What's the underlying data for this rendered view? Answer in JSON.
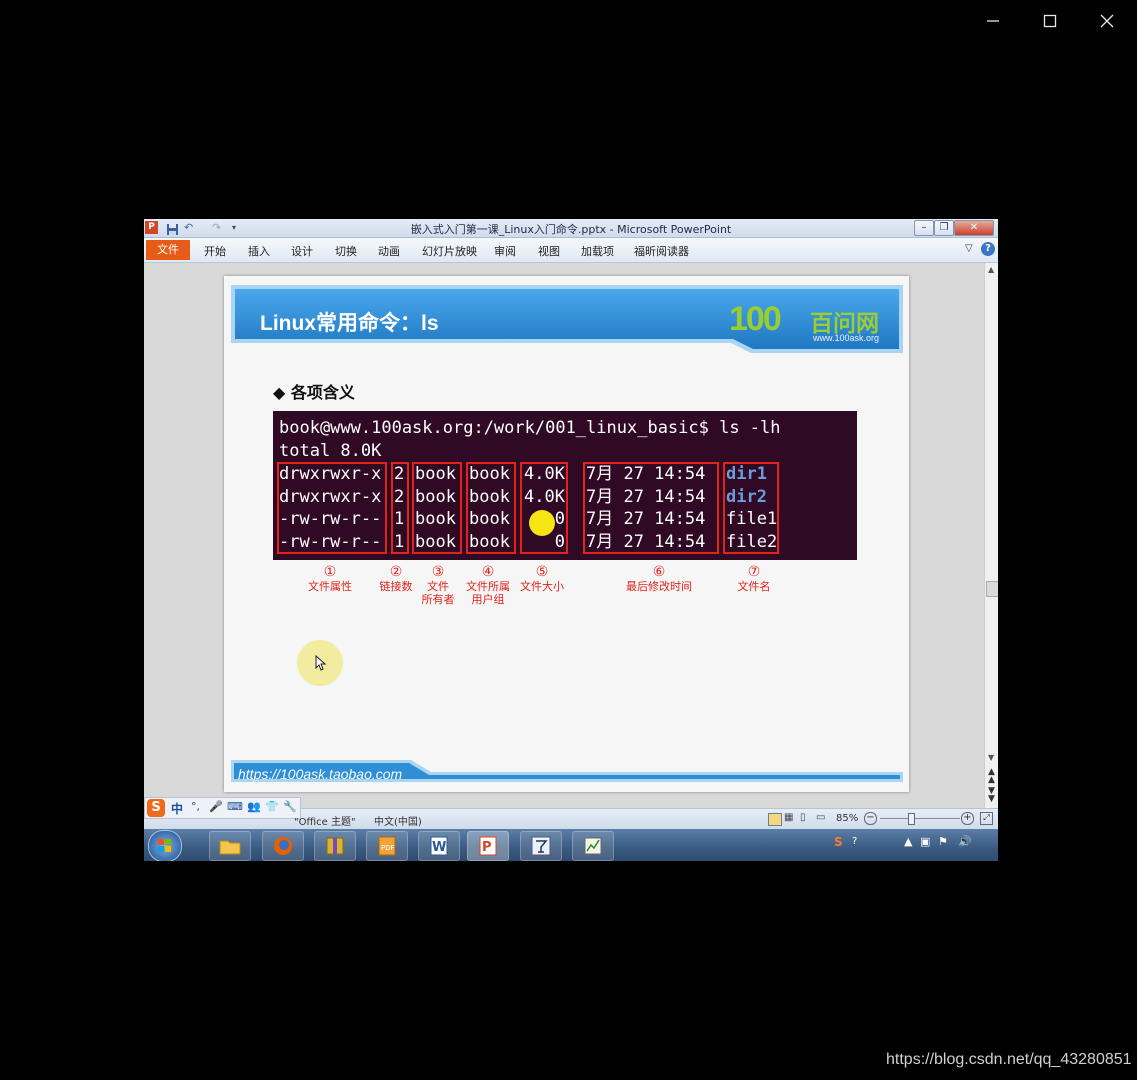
{
  "player": {
    "controls": [
      "minimize-icon",
      "maximize-icon",
      "close-icon"
    ]
  },
  "ppt": {
    "window_title": "嵌入式入门第一课_Linux入门命令.pptx - Microsoft PowerPoint",
    "ribbon": {
      "file_tab": "文件",
      "tabs": [
        "开始",
        "插入",
        "设计",
        "切换",
        "动画",
        "幻灯片放映",
        "审阅",
        "视图",
        "加载项",
        "福昕阅读器"
      ]
    },
    "slide": {
      "title": "Linux常用命令：ls",
      "logo_number": "100",
      "logo_text": "百问网",
      "logo_url": "www.100ask.org",
      "subheading": "◆ 各项含义",
      "terminal": {
        "prompt_line": "book@www.100ask.org:/work/001_linux_basic$ ls -lh",
        "total_line": "total 8.0K",
        "rows": [
          {
            "perm": "drwxrwxr-x",
            "links": "2",
            "owner": "book",
            "group": "book",
            "size": "4.0K",
            "date": "7月 27 14:54",
            "name": "dir1",
            "is_dir": true
          },
          {
            "perm": "drwxrwxr-x",
            "links": "2",
            "owner": "book",
            "group": "book",
            "size": "4.0K",
            "date": "7月 27 14:54",
            "name": "dir2",
            "is_dir": true
          },
          {
            "perm": "-rw-rw-r--",
            "links": "1",
            "owner": "book",
            "group": "book",
            "size": "0",
            "date": "7月 27 14:54",
            "name": "file1",
            "is_dir": false
          },
          {
            "perm": "-rw-rw-r--",
            "links": "1",
            "owner": "book",
            "group": "book",
            "size": "0",
            "date": "7月 27 14:54",
            "name": "file2",
            "is_dir": false
          }
        ]
      },
      "annotations": [
        {
          "num": "①",
          "label": "文件属性"
        },
        {
          "num": "②",
          "label": "链接数"
        },
        {
          "num": "③",
          "label": "文件\n所有者"
        },
        {
          "num": "④",
          "label": "文件所属\n用户组"
        },
        {
          "num": "⑤",
          "label": "文件大小"
        },
        {
          "num": "⑥",
          "label": "最后修改时间"
        },
        {
          "num": "⑦",
          "label": "文件名"
        }
      ],
      "footer_url": "https://100ask.taobao.com"
    },
    "statusbar": {
      "theme": "\"Office 主题\"",
      "language": "中文(中国)",
      "zoom": "85%",
      "ime_label": "中"
    },
    "taskbar_apps": [
      "explorer",
      "firefox",
      "archive",
      "pdf",
      "word",
      "powerpoint",
      "app-y",
      "chart-app"
    ]
  },
  "colors": {
    "accent_red": "#e2231a",
    "terminal_bg": "#300a24",
    "banner_blue": "#2e8fd6",
    "logo_green": "#9acd32"
  },
  "watermark": "https://blog.csdn.net/qq_43280851"
}
